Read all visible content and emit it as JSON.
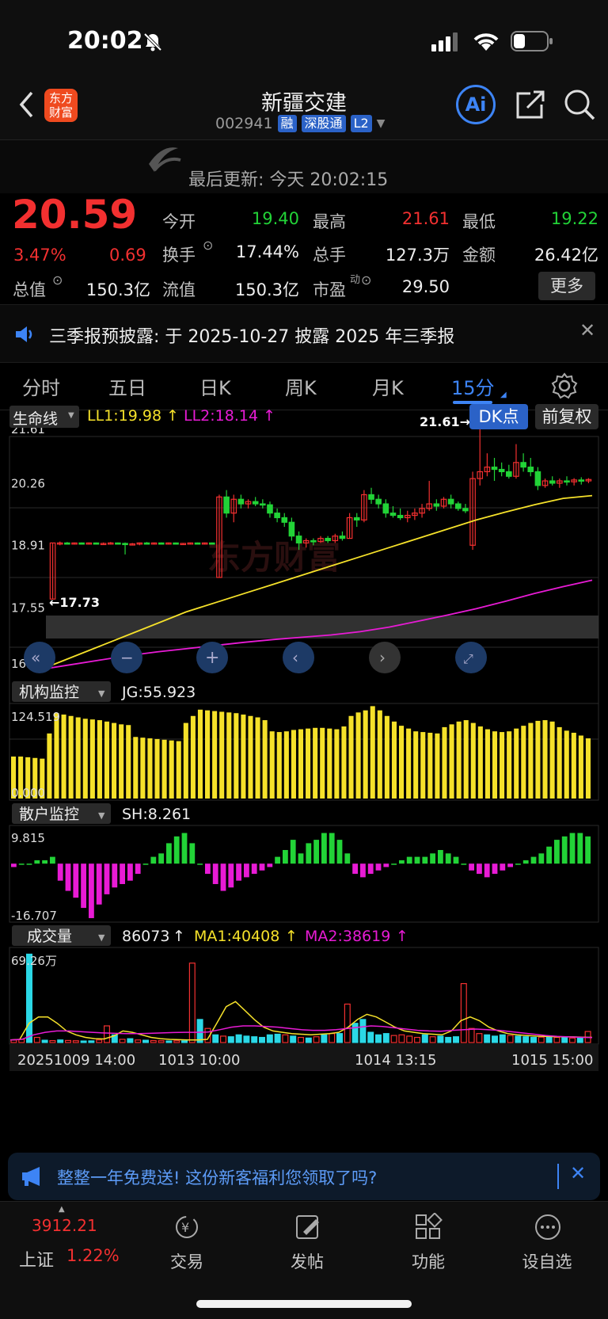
{
  "status_bar": {
    "time": "20:02"
  },
  "header": {
    "logo_text_1": "东方",
    "logo_text_2": "财富",
    "stock_name": "新疆交建",
    "stock_code": "002941",
    "tags": [
      "融",
      "深股通",
      "L2"
    ]
  },
  "refresh": {
    "text": "最后更新: 今天 20:02:15"
  },
  "quote": {
    "price": "20.59",
    "change_pct": "3.47%",
    "change_amt": "0.69",
    "open_label": "今开",
    "open": "19.40",
    "high_label": "最高",
    "high": "21.61",
    "low_label": "最低",
    "low": "19.22",
    "turnover_label": "换手",
    "turnover": "17.44%",
    "volume_label": "总手",
    "volume": "127.3万",
    "amount_label": "金额",
    "amount": "26.42亿",
    "mktcap_label": "总值",
    "mktcap": "150.3亿",
    "float_label": "流值",
    "float": "150.3亿",
    "pe_label": "市盈",
    "pe_sup": "动",
    "pe": "29.50",
    "more_button": "更多"
  },
  "notice": {
    "text": "三季报预披露: 于 2025-10-27 披露 2025 年三季报"
  },
  "tabs": [
    "分时",
    "五日",
    "日K",
    "周K",
    "月K",
    "15分"
  ],
  "active_tab": "15分",
  "chart_controls": {
    "indicator": "生命线",
    "ll1": "LL1:19.98",
    "ll2": "LL2:18.14",
    "dk_button": "DK点",
    "adjust_button": "前复权",
    "watermark": "东方财富"
  },
  "colors": {
    "up": "#f23030",
    "down": "#22d337",
    "accent": "#3d84f5",
    "yellow": "#f5e12a",
    "magenta": "#e81bd5",
    "cyan": "#2bd8e6"
  },
  "chart_data": [
    {
      "type": "candlestick",
      "title": "15分",
      "ylim": [
        16.2,
        21.61
      ],
      "ticks": [
        "21.61",
        "20.26",
        "18.91",
        "17.55",
        "16.20"
      ],
      "annotations": {
        "high_mark": "21.61→",
        "low_mark": "←17.73"
      },
      "x_labels": [
        "20251009 14:00",
        "1013 10:00",
        "1014 13:15",
        "1015 15:00"
      ],
      "candles": [
        [
          17.73,
          18.95,
          17.73,
          18.95
        ],
        [
          18.95,
          18.98,
          18.9,
          18.95
        ],
        [
          18.95,
          18.97,
          18.92,
          18.94
        ],
        [
          18.94,
          18.96,
          18.92,
          18.95
        ],
        [
          18.95,
          18.96,
          18.93,
          18.94
        ],
        [
          18.94,
          18.96,
          18.92,
          18.95
        ],
        [
          18.95,
          18.96,
          18.93,
          18.94
        ],
        [
          18.94,
          18.96,
          18.92,
          18.94
        ],
        [
          18.94,
          18.97,
          18.92,
          18.95
        ],
        [
          18.95,
          18.96,
          18.93,
          18.94
        ],
        [
          18.94,
          18.96,
          18.7,
          18.92
        ],
        [
          18.92,
          18.95,
          18.9,
          18.93
        ],
        [
          18.93,
          18.96,
          18.9,
          18.95
        ],
        [
          18.95,
          18.97,
          18.92,
          18.94
        ],
        [
          18.94,
          18.96,
          18.92,
          18.95
        ],
        [
          18.95,
          18.96,
          18.93,
          18.94
        ],
        [
          18.94,
          18.96,
          18.92,
          18.95
        ],
        [
          18.95,
          18.96,
          18.93,
          18.94
        ],
        [
          18.94,
          18.95,
          18.92,
          18.94
        ],
        [
          18.94,
          18.96,
          18.92,
          18.95
        ],
        [
          18.95,
          18.96,
          18.93,
          18.94
        ],
        [
          18.94,
          18.96,
          18.92,
          18.95
        ],
        [
          18.95,
          18.96,
          18.93,
          18.94
        ],
        [
          18.2,
          20.0,
          18.2,
          19.95
        ],
        [
          19.95,
          20.1,
          19.5,
          19.6
        ],
        [
          19.6,
          20.0,
          19.4,
          19.9
        ],
        [
          19.9,
          20.0,
          19.7,
          19.8
        ],
        [
          19.8,
          19.9,
          19.7,
          19.85
        ],
        [
          19.85,
          19.95,
          19.75,
          19.8
        ],
        [
          19.8,
          19.9,
          19.7,
          19.78
        ],
        [
          19.78,
          19.85,
          19.5,
          19.6
        ],
        [
          19.6,
          19.7,
          19.4,
          19.5
        ],
        [
          19.5,
          19.6,
          19.3,
          19.4
        ],
        [
          19.4,
          19.5,
          19.0,
          19.1
        ],
        [
          19.1,
          19.2,
          18.8,
          18.95
        ],
        [
          18.95,
          19.05,
          18.85,
          19.0
        ],
        [
          19.0,
          19.05,
          18.9,
          18.98
        ],
        [
          18.98,
          19.1,
          18.95,
          19.05
        ],
        [
          19.05,
          19.1,
          18.95,
          19.0
        ],
        [
          19.0,
          19.15,
          18.95,
          19.1
        ],
        [
          19.1,
          19.2,
          19.0,
          19.05
        ],
        [
          19.05,
          19.6,
          19.05,
          19.5
        ],
        [
          19.5,
          19.6,
          19.3,
          19.45
        ],
        [
          19.45,
          20.1,
          19.4,
          20.0
        ],
        [
          20.0,
          20.15,
          19.8,
          19.9
        ],
        [
          19.9,
          20.0,
          19.7,
          19.8
        ],
        [
          19.8,
          19.9,
          19.5,
          19.6
        ],
        [
          19.6,
          19.75,
          19.5,
          19.55
        ],
        [
          19.55,
          19.7,
          19.45,
          19.5
        ],
        [
          19.5,
          19.65,
          19.4,
          19.55
        ],
        [
          19.55,
          19.7,
          19.45,
          19.6
        ],
        [
          19.6,
          19.8,
          19.5,
          19.7
        ],
        [
          19.7,
          20.3,
          19.65,
          19.8
        ],
        [
          19.8,
          19.9,
          19.65,
          19.75
        ],
        [
          19.75,
          19.95,
          19.7,
          19.9
        ],
        [
          19.9,
          20.0,
          19.7,
          19.8
        ],
        [
          19.8,
          19.85,
          19.65,
          19.7
        ],
        [
          19.7,
          19.8,
          19.6,
          19.65
        ],
        [
          18.9,
          20.5,
          18.8,
          20.35
        ],
        [
          20.35,
          21.61,
          20.2,
          20.5
        ],
        [
          20.5,
          20.9,
          20.4,
          20.6
        ],
        [
          20.6,
          20.8,
          20.3,
          20.55
        ],
        [
          20.55,
          20.7,
          20.4,
          20.5
        ],
        [
          20.5,
          20.65,
          20.35,
          20.4
        ],
        [
          20.4,
          21.1,
          20.35,
          20.7
        ],
        [
          20.7,
          20.9,
          20.5,
          20.6
        ],
        [
          20.6,
          20.8,
          20.4,
          20.5
        ],
        [
          20.5,
          20.6,
          20.1,
          20.2
        ],
        [
          20.2,
          20.35,
          20.15,
          20.3
        ],
        [
          20.3,
          20.4,
          20.2,
          20.25
        ],
        [
          20.25,
          20.35,
          20.15,
          20.3
        ],
        [
          20.3,
          20.4,
          20.2,
          20.28
        ],
        [
          20.28,
          20.36,
          20.2,
          20.32
        ],
        [
          20.32,
          20.38,
          20.22,
          20.3
        ],
        [
          20.3,
          20.36,
          20.25,
          20.33
        ]
      ],
      "series": [
        {
          "name": "LL1",
          "values": [
            16.2,
            16.45,
            16.7,
            16.95,
            17.2,
            17.45,
            17.65,
            17.85,
            18.05,
            18.25,
            18.45,
            18.65,
            18.85,
            19.05,
            19.25,
            19.45,
            19.62,
            19.78,
            19.92,
            19.98
          ]
        },
        {
          "name": "LL2",
          "values": [
            16.2,
            16.3,
            16.4,
            16.5,
            16.58,
            16.65,
            16.72,
            16.79,
            16.85,
            16.9,
            16.95,
            17.02,
            17.12,
            17.25,
            17.38,
            17.52,
            17.68,
            17.85,
            18.0,
            18.14
          ]
        }
      ]
    },
    {
      "type": "bar",
      "indicator": "机构监控",
      "value_label": "JG:55.923",
      "ylim": [
        0,
        124.519
      ],
      "ticks": [
        "124.519",
        "0.000"
      ],
      "values": [
        60,
        60,
        59,
        58,
        57,
        93,
        122,
        120,
        118,
        116,
        114,
        113,
        112,
        110,
        108,
        106,
        105,
        88,
        87,
        86,
        85,
        84,
        83,
        82,
        108,
        118,
        127,
        126,
        125,
        124,
        123,
        122,
        120,
        118,
        116,
        112,
        96,
        95,
        96,
        98,
        99,
        100,
        101,
        101,
        100,
        99,
        103,
        118,
        123,
        126,
        132,
        126,
        118,
        110,
        104,
        100,
        96,
        95,
        94,
        93,
        102,
        106,
        110,
        112,
        108,
        103,
        99,
        96,
        95,
        96,
        100,
        104,
        108,
        111,
        112,
        110,
        102,
        97,
        94,
        90,
        86
      ]
    },
    {
      "type": "bar",
      "indicator": "散户监控",
      "value_label": "SH:8.261",
      "ylim": [
        -16.707,
        9.815
      ],
      "ticks": [
        "9.815",
        "-16.707"
      ],
      "values": [
        -1,
        0,
        0,
        1,
        1,
        2,
        -5,
        -8,
        -10,
        -13,
        -16,
        -12,
        -9,
        -7,
        -6,
        -5,
        -3,
        0,
        2,
        3,
        6,
        8,
        9,
        6,
        0,
        -3,
        -6,
        -8,
        -7,
        -5,
        -4,
        -3,
        -2,
        -1,
        2,
        4,
        7,
        3,
        6,
        7,
        9,
        9,
        7,
        3,
        -3,
        -4,
        -3,
        -2,
        -1,
        0,
        1,
        2,
        2,
        2,
        3,
        4,
        3,
        2,
        0,
        -2,
        -3,
        -4,
        -3,
        -2,
        -1,
        0,
        1,
        2,
        3,
        5,
        7,
        8,
        9,
        9,
        8
      ]
    },
    {
      "type": "bar",
      "indicator": "成交量",
      "value_label": "86073",
      "ma1_label": "MA1:40408",
      "ma2_label": "MA2:38619",
      "ylim": [
        0,
        692600
      ],
      "ticks": [
        "69.26万"
      ],
      "values": [
        20000,
        25000,
        690000,
        40000,
        18000,
        15000,
        20000,
        16000,
        14000,
        12000,
        13000,
        20000,
        130000,
        60000,
        25000,
        30000,
        20000,
        18000,
        15000,
        14000,
        12000,
        14000,
        13000,
        620000,
        180000,
        110000,
        60000,
        50000,
        45000,
        60000,
        50000,
        45000,
        40000,
        60000,
        65000,
        60000,
        50000,
        40000,
        35000,
        45000,
        60000,
        70000,
        70000,
        300000,
        150000,
        180000,
        80000,
        60000,
        70000,
        55000,
        60000,
        50000,
        40000,
        60000,
        45000,
        50000,
        40000,
        45000,
        460000,
        110000,
        70000,
        60000,
        50000,
        60000,
        55000,
        50000,
        45000,
        40000,
        42000,
        45000,
        40000,
        38000,
        35000,
        40000,
        86073
      ],
      "series": [
        {
          "name": "MA1",
          "values": [
            20000,
            25000,
            150000,
            200000,
            200000,
            150000,
            90000,
            60000,
            40000,
            30000,
            28000,
            50000,
            90000,
            80000,
            60000,
            40000,
            30000,
            25000,
            22000,
            20000,
            20000,
            25000,
            150000,
            280000,
            320000,
            250000,
            180000,
            120000,
            90000,
            80000,
            70000,
            65000,
            60000,
            65000,
            70000,
            80000,
            120000,
            180000,
            220000,
            200000,
            160000,
            120000,
            90000,
            80000,
            70000,
            65000,
            60000,
            90000,
            170000,
            200000,
            170000,
            120000,
            90000,
            70000,
            60000,
            55000,
            50000,
            48000,
            46000,
            45000,
            44000,
            42000,
            40408
          ]
        },
        {
          "name": "MA2",
          "values": [
            20000,
            25000,
            60000,
            80000,
            90000,
            90000,
            85000,
            80000,
            75000,
            72000,
            70000,
            70000,
            72000,
            75000,
            78000,
            80000,
            80000,
            82000,
            100000,
            120000,
            130000,
            130000,
            125000,
            120000,
            110000,
            100000,
            95000,
            95000,
            100000,
            110000,
            120000,
            130000,
            125000,
            115000,
            105000,
            95000,
            90000,
            88000,
            95000,
            100000,
            105000,
            100000,
            95000,
            85000,
            75000,
            65000,
            55000,
            48000,
            44000,
            41000,
            38619
          ]
        }
      ]
    }
  ],
  "ad_banner": {
    "text": "整整一年免费送! 这份新客福利您领取了吗?"
  },
  "bottom_nav": {
    "index_value": "3912.21",
    "index_name": "上证",
    "index_change": "1.22%",
    "items": [
      "交易",
      "发帖",
      "功能",
      "设自选"
    ]
  }
}
